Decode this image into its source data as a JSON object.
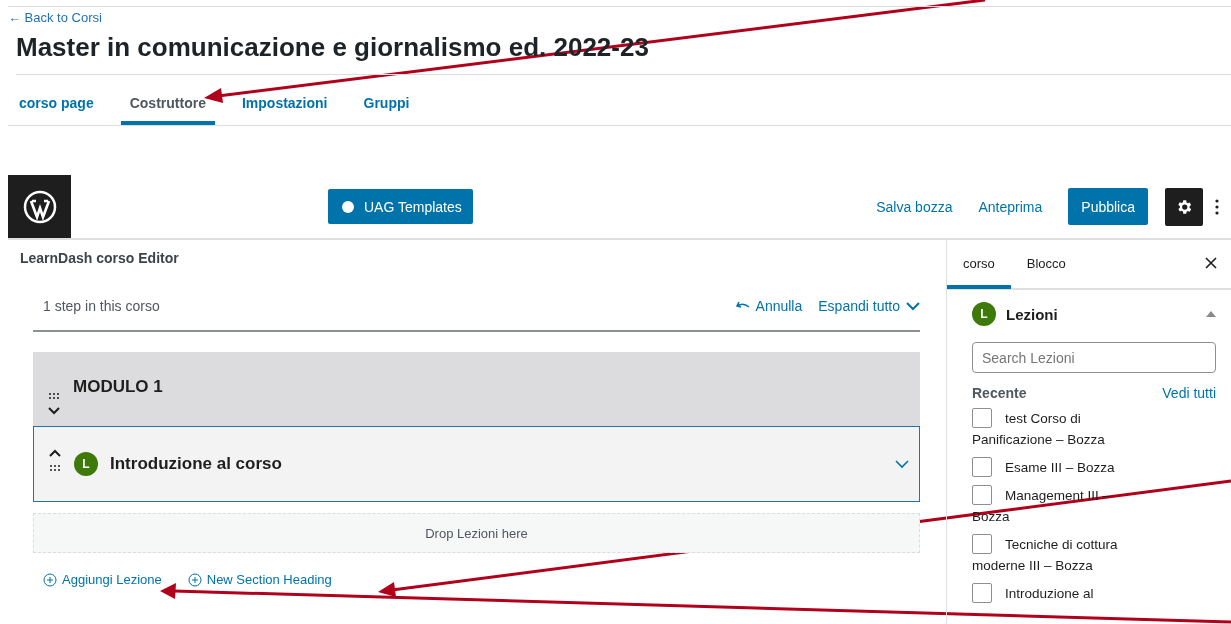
{
  "back_link": "← Back to Corsi",
  "title": "Master in comunicazione e giornalismo ed. 2022-23",
  "tabs": [
    {
      "label": "corso page",
      "selected": false
    },
    {
      "label": "Costruttore",
      "selected": true
    },
    {
      "label": "Impostazioni",
      "selected": false
    },
    {
      "label": "Gruppi",
      "selected": false
    }
  ],
  "toolbar": {
    "template_button": "UAG Templates",
    "save_draft": "Salva bozza",
    "preview": "Anteprima",
    "publish": "Pubblica",
    "settings_on": true
  },
  "builder": {
    "heading": "LearnDash corso Editor",
    "step_count": "1 step in this corso",
    "undo": "Annulla",
    "expand_all": "Espandi tutto",
    "sections": [
      {
        "kind": "heading",
        "title": "MODULO 1"
      },
      {
        "kind": "lesson",
        "badge": "L",
        "title": "Introduzione al corso"
      }
    ],
    "drop_zone": "Drop Lezioni here",
    "actions": [
      "Aggiungi Lezione",
      "New Section Heading"
    ]
  },
  "sidebar": {
    "tabs": [
      {
        "label": "corso",
        "selected": true
      },
      {
        "label": "Blocco",
        "selected": false
      }
    ],
    "panel": {
      "badge": "L",
      "title": "Lezioni",
      "expanded": true,
      "search_placeholder": "Search Lezioni",
      "recent_label": "Recente",
      "see_all": "Vedi tutti",
      "items": [
        {
          "label": "test Corso di Panificazione – Bozza",
          "checked": false
        },
        {
          "label": "Esame III – Bozza",
          "checked": false
        },
        {
          "label": "Management III – Bozza",
          "checked": false
        },
        {
          "label": "Tecniche di cottura moderne III – Bozza",
          "checked": false
        },
        {
          "label": "Introduzione al",
          "checked": false
        }
      ]
    }
  }
}
